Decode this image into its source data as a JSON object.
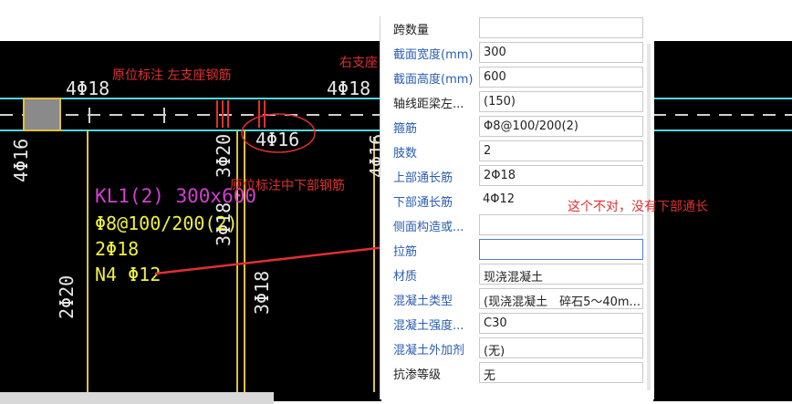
{
  "cad": {
    "top_left_rebar": "4Φ18",
    "top_right_rebar": "4Φ18",
    "middle_rebar": "4Φ16",
    "left_col_rebar": "4Φ16",
    "stirrup_col_label": "3Φ20",
    "right_col_label": "4Φ16",
    "beam_name": "KL1(2) 300x600",
    "beam_stirrup": "Φ8@100/200(2)",
    "beam_top": "2Φ18",
    "beam_bottom": "N4 Φ12",
    "bottom_left_rebar": "2Φ20",
    "bottom_mid_rebar": "3Φ18",
    "bottom_right_rebar": "3Φ18"
  },
  "notes": {
    "left_support": "原位标注 左支座钢筋",
    "right_support": "右支座",
    "mid_bottom": "原位标注中下部钢筋",
    "wrong": "这个不对，没有下部通长"
  },
  "panel": {
    "rows": [
      {
        "name": "跨数量",
        "value": ""
      },
      {
        "name": "截面宽度(mm)",
        "value": "300"
      },
      {
        "name": "截面高度(mm)",
        "value": "600"
      },
      {
        "name": "轴线距梁左...",
        "value": "(150)"
      },
      {
        "name": "箍筋",
        "value": "Φ8@100/200(2)"
      },
      {
        "name": "肢数",
        "value": "2"
      },
      {
        "name": "上部通长筋",
        "value": "2Φ18"
      },
      {
        "name": "下部通长筋",
        "value": "4Φ12"
      },
      {
        "name": "侧面构造或...",
        "value": ""
      },
      {
        "name": "拉筋",
        "value": ""
      },
      {
        "name": "材质",
        "value": "现浇混凝土"
      },
      {
        "name": "混凝土类型",
        "value": "(现浇混凝土　碎石5～40m..."
      },
      {
        "name": "混凝土强度...",
        "value": "C30"
      },
      {
        "name": "混凝土外加剂",
        "value": "(无)"
      },
      {
        "name": "抗渗等级",
        "value": "无"
      }
    ]
  },
  "colors": {
    "cad_bg": "#000000",
    "beam_cyan": "#4fd8e0",
    "cad_text": "#e8e8e8",
    "magenta": "#d040d0",
    "yellow": "#f0f040",
    "annotation_red": "#e03030",
    "label_blue": "#2a5db0"
  }
}
